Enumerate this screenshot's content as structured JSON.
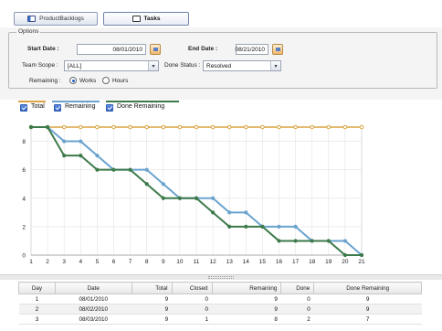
{
  "toolbar": {
    "product_backlogs_label": "ProductBacklogs",
    "tasks_label": "Tasks"
  },
  "options": {
    "legend": "Options",
    "start_date_label": "Start Date :",
    "start_date_value": "08/01/2010",
    "end_date_label": "End Date :",
    "end_date_value": "08/21/2010",
    "team_scope_label": "Team Scope :",
    "team_scope_value": "[ALL]",
    "done_status_label": "Done Status :",
    "done_status_value": "Resolved",
    "remaining_label": "Remaining :",
    "remaining_options": [
      "Works",
      "Hours"
    ],
    "remaining_selected": "Works"
  },
  "legend": {
    "items": [
      {
        "label": "Total",
        "color": "#d9a441",
        "checked": true
      },
      {
        "label": "Remaining",
        "color": "#6aa3cf",
        "checked": true
      },
      {
        "label": "Done Remaining",
        "color": "#3d7a4a",
        "checked": true
      }
    ]
  },
  "chart_data": {
    "type": "line",
    "x": [
      1,
      2,
      3,
      4,
      5,
      6,
      7,
      8,
      9,
      10,
      11,
      12,
      13,
      14,
      15,
      16,
      17,
      18,
      19,
      20,
      21
    ],
    "ylim": [
      0,
      9
    ],
    "yticks": [
      0,
      2,
      4,
      6,
      8
    ],
    "series": [
      {
        "name": "Total",
        "color": "#d9a441",
        "values": [
          9,
          9,
          9,
          9,
          9,
          9,
          9,
          9,
          9,
          9,
          9,
          9,
          9,
          9,
          9,
          9,
          9,
          9,
          9,
          9,
          9
        ]
      },
      {
        "name": "Remaining",
        "color": "#6aa3cf",
        "values": [
          9,
          9,
          8,
          8,
          7,
          6,
          6,
          6,
          5,
          4,
          4,
          4,
          3,
          3,
          2,
          2,
          2,
          1,
          1,
          1,
          0
        ]
      },
      {
        "name": "Done Remaining",
        "color": "#3d7a4a",
        "values": [
          9,
          9,
          7,
          7,
          6,
          6,
          6,
          5,
          4,
          4,
          4,
          3,
          2,
          2,
          2,
          1,
          1,
          1,
          1,
          0,
          0
        ]
      }
    ]
  },
  "table": {
    "headers": [
      "Day",
      "Date",
      "Total",
      "Closed",
      "Remaining",
      "Done",
      "Done Remaining"
    ],
    "rows": [
      [
        "1",
        "08/01/2010",
        "9",
        "0",
        "9",
        "0",
        "9"
      ],
      [
        "2",
        "08/02/2010",
        "9",
        "0",
        "9",
        "0",
        "9"
      ],
      [
        "3",
        "08/03/2010",
        "9",
        "1",
        "8",
        "2",
        "7"
      ]
    ]
  }
}
